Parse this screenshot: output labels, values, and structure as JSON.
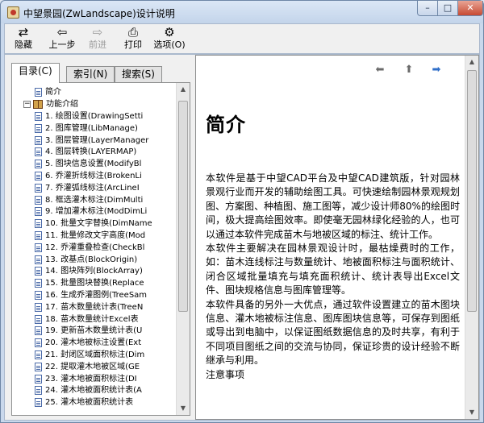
{
  "window": {
    "title": "中望景园(ZwLandscape)设计说明",
    "minimize_label": "–",
    "maximize_label": "□",
    "close_label": "✕"
  },
  "toolbar": {
    "buttons": [
      {
        "label": "隐藏",
        "icon": "hide-icon",
        "glyph": "⇄",
        "enabled": true
      },
      {
        "label": "上一步",
        "icon": "back-icon",
        "glyph": "⇦",
        "enabled": true
      },
      {
        "label": "前进",
        "icon": "forward-icon",
        "glyph": "⇨",
        "enabled": false
      },
      {
        "label": "打印",
        "icon": "print-icon",
        "glyph": "⎙",
        "enabled": true
      },
      {
        "label": "选项(O)",
        "icon": "options-icon",
        "glyph": "⚙",
        "enabled": true
      }
    ]
  },
  "tabs": [
    {
      "label": "目录(C)",
      "active": true
    },
    {
      "label": "索引(N)",
      "active": false
    },
    {
      "label": "搜索(S)",
      "active": false
    }
  ],
  "tree": {
    "top": {
      "label": "简介"
    },
    "group": {
      "label": "功能介绍",
      "expander": "−"
    },
    "items": [
      "1. 绘图设置(DrawingSetti",
      "2. 图库管理(LibManage)",
      "3. 图层管理(LayerManager",
      "4. 图层转换(LAYERMAP)",
      "5. 图块信息设置(ModifyBl",
      "6. 乔灌折线标注(BrokenLi",
      "7. 乔灌弧线标注(ArcLineI",
      "8. 框选灌木标注(DimMulti",
      "9. 增加灌木标注(ModDimLi",
      "10. 批量文字替换(DimName",
      "11. 批量修改文字高度(Mod",
      "12. 乔灌重叠检查(CheckBl",
      "13. 改基点(BlockOrigin)",
      "14. 图块阵列(BlockArray)",
      "15. 批量图块替换(Replace",
      "16. 生成乔灌图例(TreeSam",
      "17. 苗木数量统计表(TreeN",
      "18. 苗木数量统计Excel表",
      "19. 更新苗木数量统计表(U",
      "20. 灌木地被标注设置(Ext",
      "21. 封闭区域面积标注(Dim",
      "22. 提取灌木地被区域(GE",
      "23. 灌木地被面积标注(DI",
      "24. 灌木地被面积统计表(A",
      "25. 灌木地被面积统计表"
    ]
  },
  "content": {
    "heading": "简介",
    "paragraphs": [
      "本软件是基于中望CAD平台及中望CAD建筑版，针对园林景观行业而开发的辅助绘图工具。可快速绘制园林景观规划图、方案图、种植图、施工图等，减少设计师80%的绘图时间，极大提高绘图效率。即使毫无园林绿化经验的人，也可以通过本软件完成苗木与地被区域的标注、统计工作。",
      "本软件主要解决在园林景观设计时，最枯燥费时的工作，如：苗木连线标注与数量统计、地被面积标注与面积统计、闭合区域批量填充与填充面积统计、统计表导出Excel文件、图块规格信息与图库管理等。",
      "本软件具备的另外一大优点，通过软件设置建立的苗木图块信息、灌木地被标注信息、图库图块信息等，可保存到图纸或导出到电脑中，以保证图纸数据信息的及时共享，有利于不同项目图纸之间的交流与协同，保证珍贵的设计经验不断继承与利用。",
      "注意事项"
    ]
  },
  "nav": {
    "prev_glyph": "⬅",
    "home_glyph": "⬆",
    "next_glyph": "➡"
  }
}
